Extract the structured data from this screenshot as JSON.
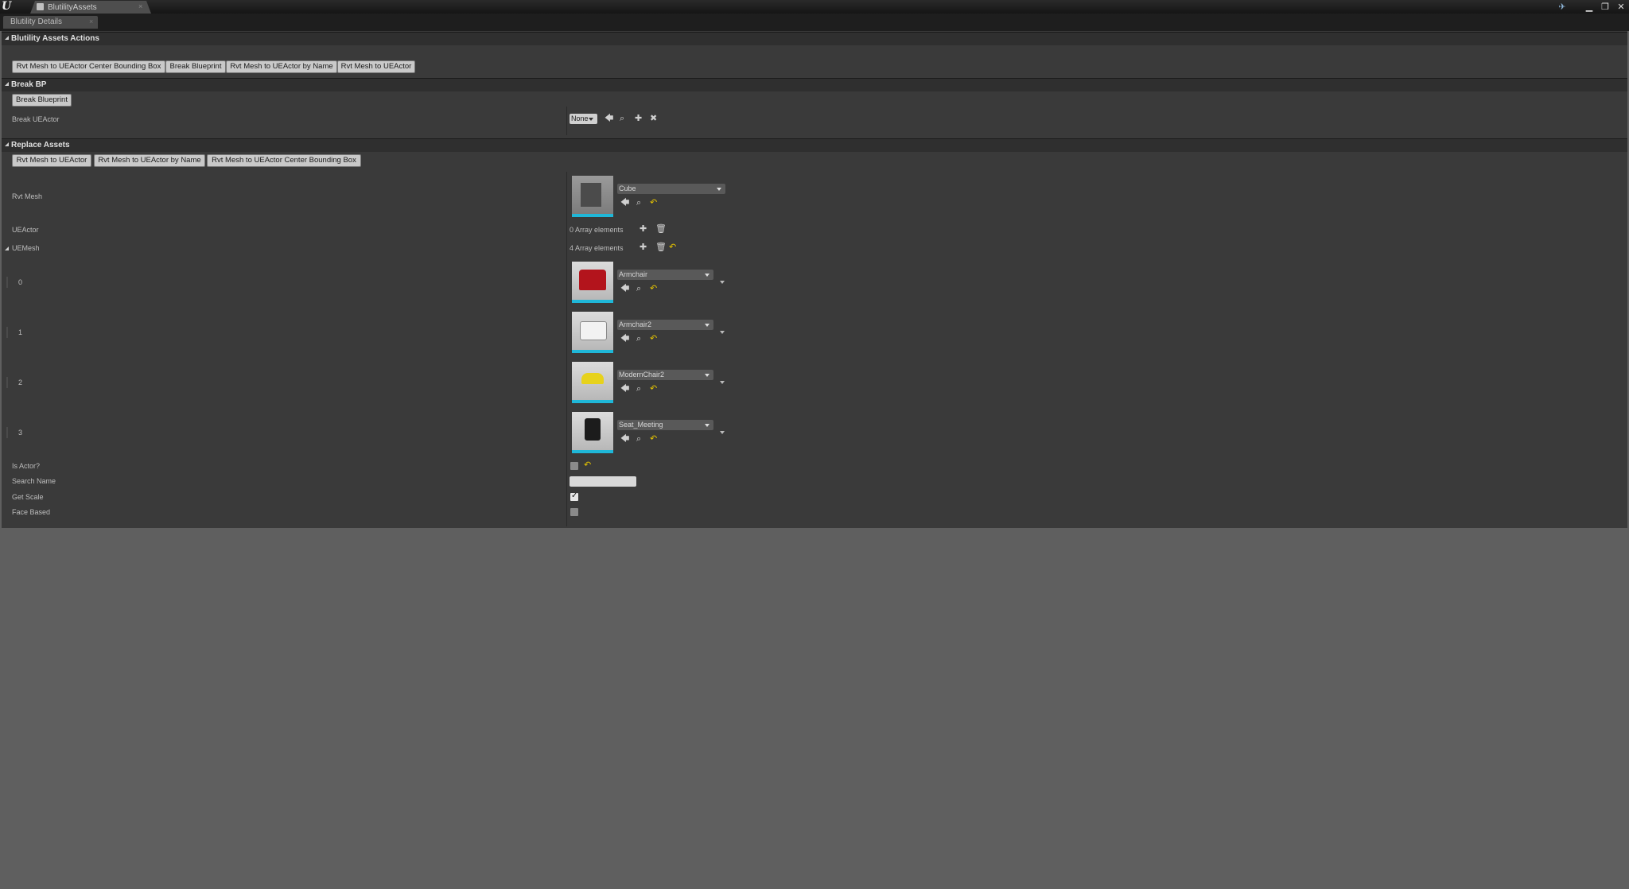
{
  "window": {
    "tab_title": "BlutilityAssets",
    "panel_tab": "Blutility Details",
    "tab_close_glyph": "×",
    "icons": {
      "help": "help-icon",
      "minimize": "minimize-icon",
      "maximize": "maximize-icon",
      "close": "close-icon"
    }
  },
  "sections": {
    "actions": {
      "title": "Blutility Assets Actions",
      "buttons": [
        "Rvt Mesh to UEActor Center Bounding Box",
        "Break Blueprint",
        "Rvt Mesh to UEActor by Name",
        "Rvt Mesh to UEActor"
      ]
    },
    "break_bp": {
      "title": "Break BP",
      "button": "Break Blueprint",
      "property_label": "Break UEActor",
      "combo_value": "None"
    },
    "replace_assets": {
      "title": "Replace Assets",
      "buttons": [
        "Rvt Mesh to UEActor",
        "Rvt Mesh to UEActor by Name",
        "Rvt Mesh to UEActor Center Bounding Box"
      ],
      "rvt_mesh": {
        "label": "Rvt Mesh",
        "value": "Cube"
      },
      "ueactor": {
        "label": "UEActor",
        "count_text": "0 Array elements"
      },
      "uemesh": {
        "label": "UEMesh",
        "count_text": "4 Array elements",
        "items": [
          {
            "index": "0",
            "value": "Armchair"
          },
          {
            "index": "1",
            "value": "Armchair2"
          },
          {
            "index": "2",
            "value": "ModernChair2"
          },
          {
            "index": "3",
            "value": "Seat_Meeting"
          }
        ]
      },
      "is_actor": {
        "label": "Is Actor?",
        "checked": false
      },
      "search_name": {
        "label": "Search Name",
        "value": ""
      },
      "get_scale": {
        "label": "Get Scale",
        "checked": true
      },
      "face_based": {
        "label": "Face Based",
        "checked": false
      }
    }
  },
  "colors": {
    "accent_thumb_bar": "#1fb7d8",
    "reset_arrow": "#e6c400"
  }
}
